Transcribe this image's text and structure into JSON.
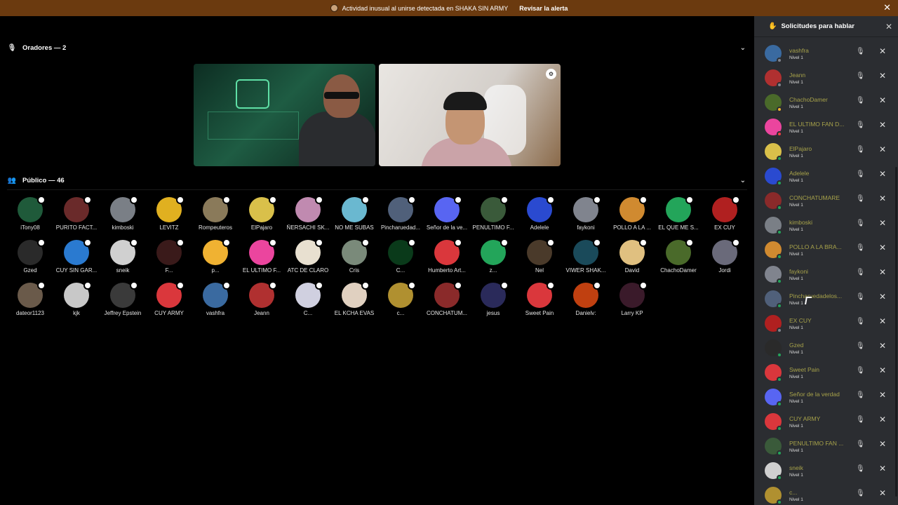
{
  "alert": {
    "text": "Actividad inusual al unirse detectada en SHAKA SIN ARMY",
    "action": "Revisar la alerta",
    "close_icon": "close-icon"
  },
  "speakers": {
    "header": "Oradores — 2"
  },
  "audience": {
    "header": "Público — 46",
    "members": [
      {
        "name": "iTony08",
        "color": "#1f5a3a"
      },
      {
        "name": "PURITO FACT...",
        "color": "#6a2a2a"
      },
      {
        "name": "kimboski",
        "color": "#7a7f86"
      },
      {
        "name": "LEVITZ",
        "color": "#e0b020"
      },
      {
        "name": "Rompeuteros",
        "color": "#8a7a5a"
      },
      {
        "name": "ElPajaro",
        "color": "#d9c04a"
      },
      {
        "name": "ÑERSACHI SK...",
        "color": "#c08ab0"
      },
      {
        "name": "NO ME SUBAS",
        "color": "#6ab8d0"
      },
      {
        "name": "Pincharuedad...",
        "color": "#50607a"
      },
      {
        "name": "Señor de la ve...",
        "color": "#5865f2"
      },
      {
        "name": "PENULTIMO F...",
        "color": "#3a5a3a"
      },
      {
        "name": "Adelele",
        "color": "#2a4ad0"
      },
      {
        "name": "faykoni",
        "color": "#80848e"
      },
      {
        "name": "POLLO A LA ...",
        "color": "#d08a30"
      },
      {
        "name": "EL QUE ME S...",
        "color": "#23a55a"
      },
      {
        "name": "EX CUY",
        "color": "#b02020"
      },
      {
        "name": "Gzed",
        "color": "#2a2a2a"
      },
      {
        "name": "CUY SIN GAR...",
        "color": "#2a7ad0"
      },
      {
        "name": "sneik",
        "color": "#d0d0d0"
      },
      {
        "name": "F...",
        "color": "#3a1a1a"
      },
      {
        "name": "p...",
        "color": "#f0b232"
      },
      {
        "name": "EL ULTIMO F...",
        "color": "#eb459e"
      },
      {
        "name": "ATC DE CLARO",
        "color": "#e8e0d0"
      },
      {
        "name": "Cris",
        "color": "#7a8a7a"
      },
      {
        "name": "C...",
        "color": "#0a3a1a"
      },
      {
        "name": "Humberto Art...",
        "color": "#da373c"
      },
      {
        "name": "z...",
        "color": "#23a55a"
      },
      {
        "name": "Nel",
        "color": "#4a3a2a"
      },
      {
        "name": "VIWER SHAK...",
        "color": "#1a4a5a"
      },
      {
        "name": "David",
        "color": "#e0c080"
      },
      {
        "name": "ChachoDamer",
        "color": "#4a6a2a"
      },
      {
        "name": "Jordi",
        "color": "#6a6a7a"
      },
      {
        "name": "dateor1123",
        "color": "#6a5a4a"
      },
      {
        "name": "kjk",
        "color": "#c8c8c8"
      },
      {
        "name": "Jeffrey Epstein",
        "color": "#3a3a3a"
      },
      {
        "name": "CUY ARMY",
        "color": "#da373c"
      },
      {
        "name": "vashfra",
        "color": "#3a6aa0"
      },
      {
        "name": "Jeann",
        "color": "#b03030"
      },
      {
        "name": "C...",
        "color": "#d0d0e0"
      },
      {
        "name": "EL KCHA EVAS",
        "color": "#e0d0c0"
      },
      {
        "name": "c...",
        "color": "#b09030"
      },
      {
        "name": "CONCHATUM...",
        "color": "#8a2a2a"
      },
      {
        "name": "jesus",
        "color": "#2a2a5a"
      },
      {
        "name": "Sweet Pain",
        "color": "#da373c"
      },
      {
        "name": "Danielv:",
        "color": "#c04010"
      },
      {
        "name": "Larry KP",
        "color": "#3a1a2a"
      }
    ]
  },
  "panel": {
    "title": "Solicitudes para hablar",
    "level_label": "Nivel 1",
    "requests": [
      {
        "name": "vashfra",
        "color": "#3a6aa0",
        "status": "#80848e"
      },
      {
        "name": "Jeann",
        "color": "#b03030",
        "status": "#80848e"
      },
      {
        "name": "ChachoDamer",
        "color": "#4a6a2a",
        "status": "#f0b232"
      },
      {
        "name": "EL ULTIMO FAN D...",
        "color": "#eb459e",
        "status": "#f23f43"
      },
      {
        "name": "ElPajaro",
        "color": "#d9c04a",
        "status": "#23a55a"
      },
      {
        "name": "Adelele",
        "color": "#2a4ad0",
        "status": "#23a55a"
      },
      {
        "name": "CONCHATUMARE",
        "color": "#8a2a2a",
        "status": "#23a55a"
      },
      {
        "name": "kimboski",
        "color": "#7a7f86",
        "status": "#23a55a"
      },
      {
        "name": "POLLO A LA BRA...",
        "color": "#d08a30",
        "status": "#23a55a"
      },
      {
        "name": "faykoni",
        "color": "#80848e",
        "status": "#23a55a"
      },
      {
        "name": "Pincharuedadelos...",
        "color": "#50607a",
        "status": "#23a55a"
      },
      {
        "name": "EX CUY",
        "color": "#b02020",
        "status": "#80848e"
      },
      {
        "name": "Gzed",
        "color": "#2a2a2a",
        "status": "#23a55a"
      },
      {
        "name": "Sweet Pain",
        "color": "#da373c",
        "status": "#23a55a"
      },
      {
        "name": "Señor de la verdad",
        "color": "#5865f2",
        "status": "#23a55a"
      },
      {
        "name": "CUY ARMY",
        "color": "#da373c",
        "status": "#23a55a"
      },
      {
        "name": "PENULTIMO FAN ...",
        "color": "#3a5a3a",
        "status": "#23a55a"
      },
      {
        "name": "sneik",
        "color": "#d0d0d0",
        "status": "#23a55a"
      },
      {
        "name": "c...",
        "color": "#b09030",
        "status": "#23a55a"
      }
    ]
  }
}
